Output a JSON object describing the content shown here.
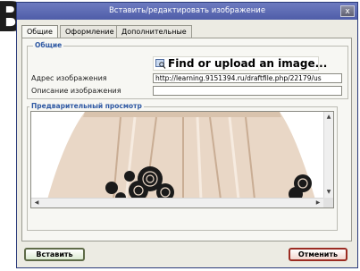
{
  "background": {
    "partial_text": "B"
  },
  "dialog": {
    "title": "Вставить/редактировать изображение",
    "close_label": "x",
    "tabs": [
      {
        "label": "Общие",
        "active": true
      },
      {
        "label": "Оформление",
        "active": false
      },
      {
        "label": "Дополнительные",
        "active": false
      }
    ],
    "general": {
      "legend": "Общие",
      "find_upload_label": "Find or upload an image...",
      "image_url_label": "Адрес изображения",
      "image_url_value": "http://learning.9151394.ru/draftfile.php/22179/us",
      "description_label": "Описание изображения",
      "description_value": ""
    },
    "preview": {
      "legend": "Предварительный просмотр"
    },
    "buttons": {
      "insert": "Вставить",
      "cancel": "Отменить"
    }
  },
  "colors": {
    "titlebar": "#5664ae",
    "legend": "#2f59a3",
    "insert_border": "#5f6b48",
    "cancel_border": "#9b2c22"
  },
  "icons": [
    "image-search-icon",
    "close-icon",
    "scroll-up-icon",
    "scroll-down-icon",
    "scroll-left-icon",
    "scroll-right-icon"
  ]
}
